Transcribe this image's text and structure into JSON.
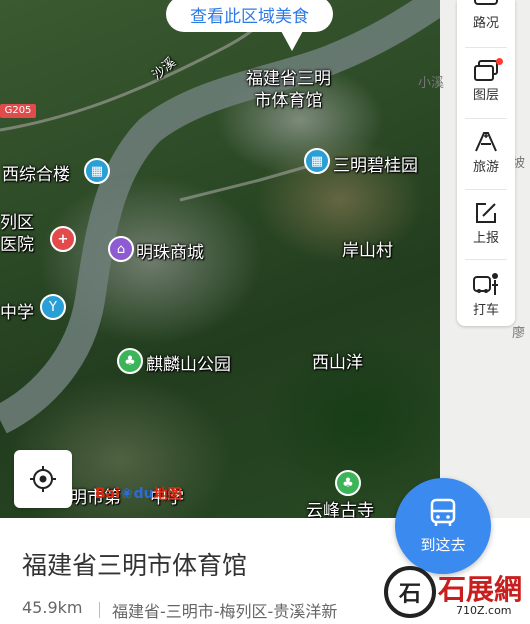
{
  "top_button": {
    "label": "查看此区域美食"
  },
  "toolbar": {
    "items": [
      {
        "label": "路况",
        "icon": "traffic-icon"
      },
      {
        "label": "图层",
        "icon": "layers-icon",
        "has_badge": true
      },
      {
        "label": "旅游",
        "icon": "travel-icon"
      },
      {
        "label": "上报",
        "icon": "report-icon"
      },
      {
        "label": "打车",
        "icon": "taxi-icon"
      }
    ]
  },
  "map": {
    "labels": {
      "gymnasium": "福建省三明\n市体育馆",
      "xisonghe_building": "西综合楼",
      "sanming_biguiyuan": "三明碧桂园",
      "mingzhu_mall": "明珠商城",
      "hospital_partial": "列区\n医院",
      "middle_school": "中学",
      "yanshan_village": "岸山村",
      "qilinshan_park": "麒麟山公园",
      "xishanyang": "西山洋",
      "yunfeng_temple": "云峰古寺",
      "bottom_school": "明市第",
      "bottom_school_2": "中学",
      "road_g205": "G205",
      "river_side": "沙溪",
      "xiaoxi": "小溪",
      "side_po": "坡",
      "side_liao": "廖"
    },
    "poi_colors": {
      "blue": "#2a9fd6",
      "red": "#e24b4b",
      "purple": "#8e5bd3",
      "green": "#3cb55a"
    }
  },
  "logo": {
    "bai": "Bai",
    "du": "du",
    "ditu": "地图"
  },
  "panel": {
    "name": "福建省三明市体育馆",
    "distance": "45.9km",
    "address": "福建省-三明市-梅列区-贵溪洋新"
  },
  "go_button": {
    "label": "到这去"
  },
  "watermark": {
    "text": "石展網",
    "url": "710Z.com",
    "circle": "石"
  },
  "colors": {
    "accent": "#3a8af0",
    "food_text": "#2d7be7"
  }
}
